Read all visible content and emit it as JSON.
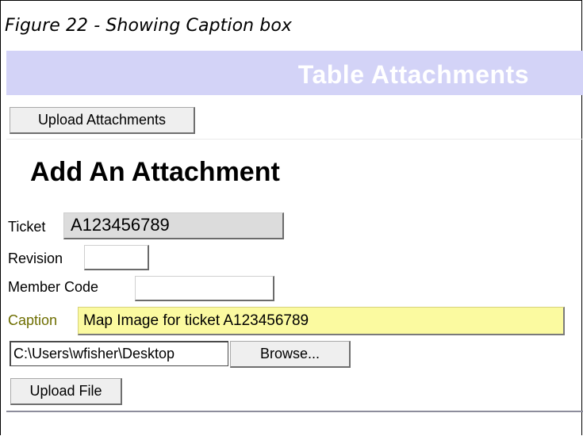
{
  "figure_caption": "Figure 22 - Showing Caption box",
  "banner": {
    "title": "Table Attachments"
  },
  "toolbar": {
    "upload_attachments_label": "Upload Attachments"
  },
  "form": {
    "heading": "Add An Attachment",
    "ticket": {
      "label": "Ticket",
      "value": "A123456789"
    },
    "revision": {
      "label": "Revision",
      "value": ""
    },
    "member_code": {
      "label": "Member Code",
      "value": ""
    },
    "caption": {
      "label": "Caption",
      "value": "Map Image for ticket A123456789"
    },
    "file": {
      "value": "C:\\Users\\wfisher\\Desktop",
      "browse_label": "Browse..."
    },
    "upload_file_label": "Upload File"
  },
  "colors": {
    "banner_bg": "#d3d3f7",
    "caption_highlight": "#fbfaa0"
  }
}
